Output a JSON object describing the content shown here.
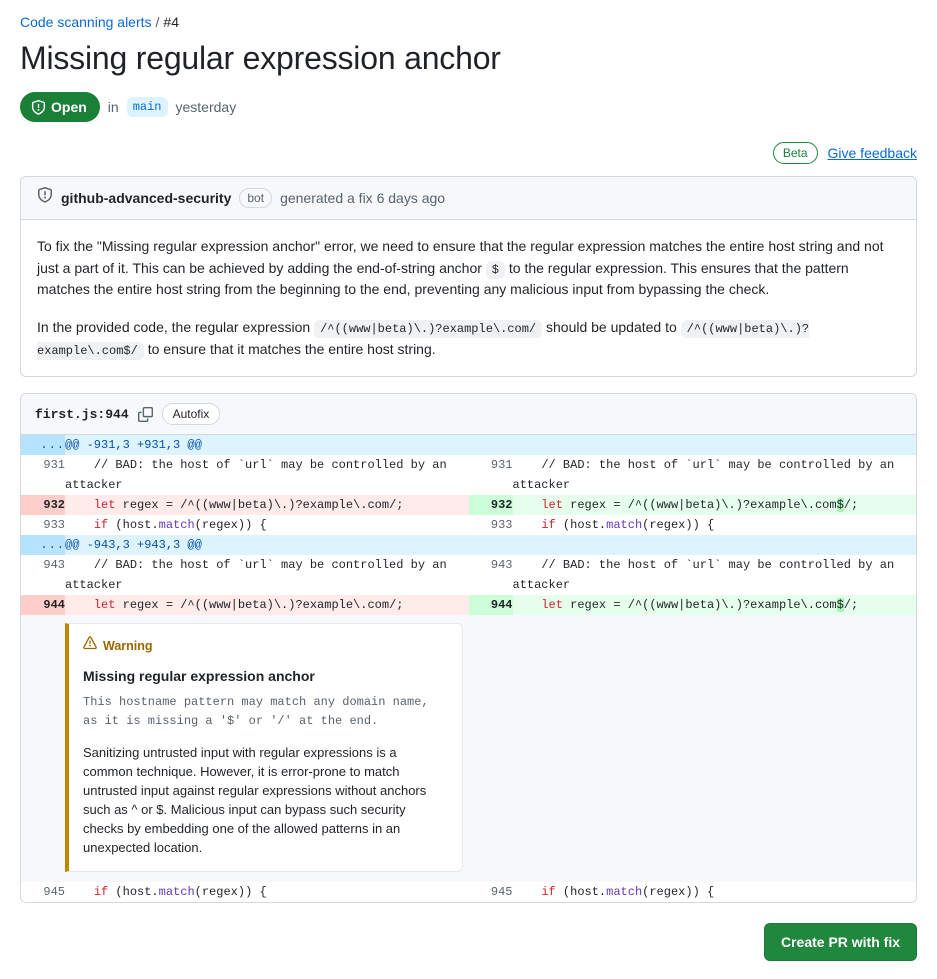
{
  "breadcrumb": {
    "parent_label": "Code scanning alerts",
    "separator": "/",
    "current": "#4"
  },
  "page_title": "Missing regular expression anchor",
  "state": {
    "badge_label": "Open",
    "badge_color": "#1a7f37",
    "in_label": "in",
    "branch": "main",
    "time": "yesterday"
  },
  "beta": {
    "badge_label": "Beta",
    "badge_color": "#1f883d",
    "feedback_label": "Give feedback",
    "feedback_color": "#0969da"
  },
  "fix_panel": {
    "author": "github-advanced-security",
    "author_type": "bot",
    "action_text": "generated a fix 6 days ago",
    "paragraphs": [
      {
        "parts": [
          {
            "type": "text",
            "value": "To fix the \"Missing regular expression anchor\" error, we need to ensure that the regular expression matches the entire host string and not just a part of it. This can be achieved by adding the end-of-string anchor "
          },
          {
            "type": "code",
            "value": "$"
          },
          {
            "type": "text",
            "value": " to the regular expression. This ensures that the pattern matches the entire host string from the beginning to the end, preventing any malicious input from bypassing the check."
          }
        ]
      },
      {
        "parts": [
          {
            "type": "text",
            "value": "In the provided code, the regular expression "
          },
          {
            "type": "code",
            "value": "/^((www|beta)\\.)?example\\.com/"
          },
          {
            "type": "text",
            "value": " should be updated to "
          },
          {
            "type": "code",
            "value": "/^((www|beta)\\.)?example\\.com$/"
          },
          {
            "type": "text",
            "value": " to ensure that it matches the entire host string."
          }
        ]
      }
    ]
  },
  "diff_panel": {
    "file_label": "first.js:944",
    "copy_icon": "copy-icon",
    "autofix_label": "Autofix",
    "rows": [
      {
        "kind": "hunk",
        "left_ln": "...",
        "left_code": "@@ -931,3 +931,3 @@",
        "right_ln": "",
        "right_code": ""
      },
      {
        "kind": "context",
        "left_ln": "931",
        "left_code": "    // BAD: the host of `url` may be controlled by an attacker",
        "right_ln": "931",
        "right_code": "    // BAD: the host of `url` may be controlled by an attacker"
      },
      {
        "kind": "change",
        "left_ln": "932",
        "left_code": "    let regex = /^((www|beta)\\.)?example\\.com/;",
        "right_ln": "932",
        "right_code": "    let regex = /^((www|beta)\\.)?example\\.com$/;"
      },
      {
        "kind": "context",
        "left_ln": "933",
        "left_code": "    if (host.match(regex)) {",
        "right_ln": "933",
        "right_code": "    if (host.match(regex)) {"
      },
      {
        "kind": "hunk",
        "left_ln": "...",
        "left_code": "@@ -943,3 +943,3 @@",
        "right_ln": "",
        "right_code": ""
      },
      {
        "kind": "context",
        "left_ln": "943",
        "left_code": "    // BAD: the host of `url` may be controlled by an attacker",
        "right_ln": "943",
        "right_code": "    // BAD: the host of `url` may be controlled by an attacker"
      },
      {
        "kind": "change",
        "left_ln": "944",
        "left_code": "    let regex = /^((www|beta)\\.)?example\\.com/;",
        "right_ln": "944",
        "right_code": "    let regex = /^((www|beta)\\.)?example\\.com$/;"
      },
      {
        "kind": "warning"
      },
      {
        "kind": "context",
        "left_ln": "945",
        "left_code": "    if (host.match(regex)) {",
        "right_ln": "945",
        "right_code": "    if (host.match(regex)) {"
      }
    ],
    "warning": {
      "severity_label": "Warning",
      "severity_color": "#9a6700",
      "icon": "warning-triangle-icon",
      "title": "Missing regular expression anchor",
      "mono_text": "This hostname pattern may match any domain name,\nas it is missing a '$' or '/' at the end.",
      "body_text": "Sanitizing untrusted input with regular expressions is a common technique. However, it is error-prone to match untrusted input against regular expressions without anchors such as ^ or $. Malicious input can bypass such security checks by embedding one of the allowed patterns in an unexpected location."
    }
  },
  "footer": {
    "create_pr_label": "Create PR with fix",
    "create_pr_color": "#1f883d"
  }
}
